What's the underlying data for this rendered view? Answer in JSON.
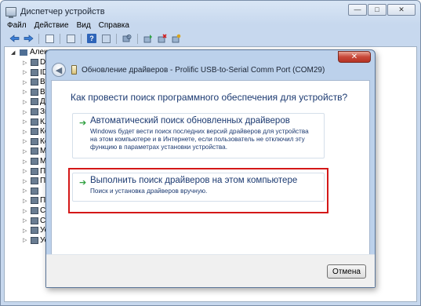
{
  "window": {
    "title": "Диспетчер устройств",
    "controls": {
      "minimize": "—",
      "maximize": "□",
      "close": "✕"
    }
  },
  "menu": [
    "Файл",
    "Действие",
    "Вид",
    "Справка"
  ],
  "toolbar": {
    "icons": [
      "back-icon",
      "forward-icon",
      "properties-icon",
      "show-hidden-icon",
      "help-icon",
      "scan-hardware-icon",
      "update-driver-icon",
      "uninstall-icon",
      "disable-icon"
    ]
  },
  "tree": {
    "root_label": "Алекс",
    "items": [
      {
        "label": "DV"
      },
      {
        "label": "ID"
      },
      {
        "label": "Bl"
      },
      {
        "label": "Вь"
      },
      {
        "label": "Ди"
      },
      {
        "label": "Зв"
      },
      {
        "label": "Кл"
      },
      {
        "label": "Ко"
      },
      {
        "label": "Ко"
      },
      {
        "label": "Мь"
      },
      {
        "label": "Мо"
      },
      {
        "label": "Пе"
      },
      {
        "label": "П"
      },
      {
        "label": ""
      },
      {
        "label": "Пр"
      },
      {
        "label": "Се"
      },
      {
        "label": "Си"
      },
      {
        "label": "Ус"
      },
      {
        "label": "Ус"
      }
    ]
  },
  "dialog": {
    "close_label": "✕",
    "title": "Обновление драйверов - Prolific USB-to-Serial Comm Port (COM29)",
    "question": "Как провести поиск программного обеспечения для устройств?",
    "options": {
      "auto": {
        "title": "Автоматический поиск обновленных драйверов",
        "description": "Windows будет вести поиск последних версий драйверов для устройства на этом компьютере и в Интернете, если пользователь не отключил эту функцию в параметрах установки устройства."
      },
      "manual": {
        "title": "Выполнить поиск драйверов на этом компьютере",
        "description": "Поиск и установка драйверов вручную."
      }
    },
    "cancel_label": "Отмена"
  },
  "colors": {
    "highlight": "#d41818",
    "link_text": "#1c3a71",
    "arrow": "#30a040"
  }
}
